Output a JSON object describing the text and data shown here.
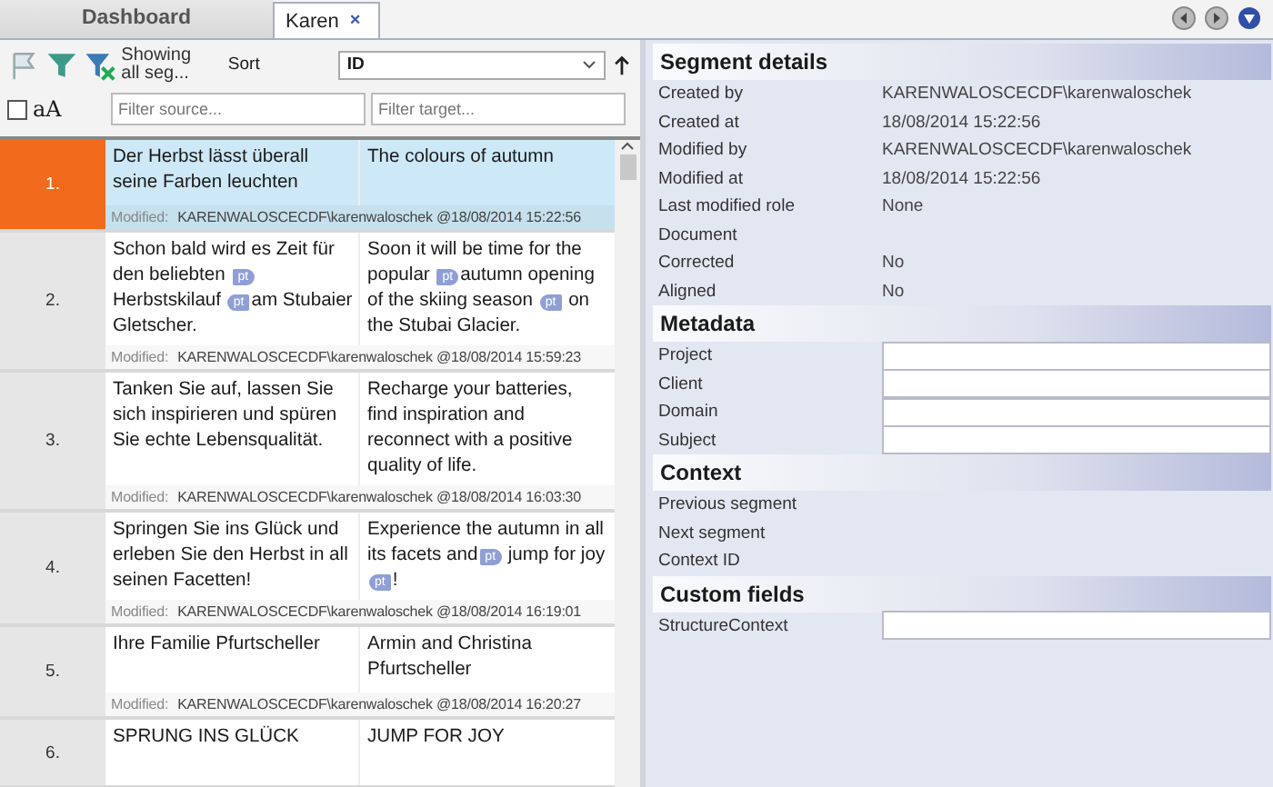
{
  "tabs": [
    {
      "label": "Dashboard",
      "selected": false
    },
    {
      "label": "Karen",
      "selected": true,
      "close": "×"
    }
  ],
  "toolbar": {
    "filter_status": "Showing all seg...",
    "sort_label": "Sort",
    "sort_value": "ID",
    "match_case": {
      "label": "aA",
      "checked": false
    },
    "source_filter": {
      "placeholder": "Filter source..."
    },
    "target_filter": {
      "placeholder": "Filter target..."
    }
  },
  "segments": [
    {
      "number": "1.",
      "selected": true,
      "source": [
        {
          "kind": "text",
          "text": "Der Herbst lässt überall seine Farben leuchten"
        }
      ],
      "target": [
        {
          "kind": "text",
          "text": "The colours of autumn"
        }
      ],
      "modified_label": "Modified:",
      "modified": "KARENWALOSCECDF\\karenwaloschek @18/08/2014 15:22:56"
    },
    {
      "number": "2.",
      "selected": false,
      "source": [
        {
          "kind": "text",
          "text": "Schon bald wird es Zeit für den beliebten "
        },
        {
          "kind": "tag_open",
          "text": "pt"
        },
        {
          "kind": "text",
          "text": "Herbstskilauf "
        },
        {
          "kind": "tag_close",
          "text": "pt"
        },
        {
          "kind": "text",
          "text": "am Stubaier Gletscher."
        }
      ],
      "target": [
        {
          "kind": "text",
          "text": "Soon it will be time for the popular "
        },
        {
          "kind": "tag_open",
          "text": "pt"
        },
        {
          "kind": "text",
          "text": "autumn opening of the skiing season "
        },
        {
          "kind": "tag_close",
          "text": "pt"
        },
        {
          "kind": "text",
          "text": " on the Stubai Glacier."
        }
      ],
      "modified_label": "Modified:",
      "modified": "KARENWALOSCECDF\\karenwaloschek @18/08/2014 15:59:23"
    },
    {
      "number": "3.",
      "selected": false,
      "source": [
        {
          "kind": "text",
          "text": "Tanken Sie auf, lassen Sie sich inspirieren und spüren Sie echte Lebensqualität."
        }
      ],
      "target": [
        {
          "kind": "text",
          "text": "Recharge your batteries, find inspiration and reconnect with a positive quality of life."
        }
      ],
      "modified_label": "Modified:",
      "modified": "KARENWALOSCECDF\\karenwaloschek @18/08/2014 16:03:30"
    },
    {
      "number": "4.",
      "selected": false,
      "source": [
        {
          "kind": "text",
          "text": "Springen Sie ins Glück und erleben Sie den Herbst in all seinen Facetten!"
        }
      ],
      "target": [
        {
          "kind": "text",
          "text": "Experience the autumn in all its facets and"
        },
        {
          "kind": "tag_open",
          "text": "pt"
        },
        {
          "kind": "text",
          "text": " jump for joy "
        },
        {
          "kind": "tag_close",
          "text": "pt"
        },
        {
          "kind": "text",
          "text": "!"
        }
      ],
      "modified_label": "Modified:",
      "modified": "KARENWALOSCECDF\\karenwaloschek @18/08/2014 16:19:01"
    },
    {
      "number": "5.",
      "selected": false,
      "source": [
        {
          "kind": "text",
          "text": "Ihre Familie Pfurtscheller"
        }
      ],
      "target": [
        {
          "kind": "text",
          "text": "Armin and Christina Pfurtscheller"
        }
      ],
      "modified_label": "Modified:",
      "modified": "KARENWALOSCECDF\\karenwaloschek @18/08/2014 16:20:27"
    },
    {
      "number": "6.",
      "selected": false,
      "source": [
        {
          "kind": "text",
          "text": "SPRUNG INS GLÜCK"
        }
      ],
      "target": [
        {
          "kind": "text",
          "text": "JUMP FOR JOY"
        }
      ]
    }
  ],
  "details": [
    {
      "title": "Segment details",
      "rows": [
        {
          "kind": "value",
          "label": "Created by",
          "value": "KARENWALOSCECDF\\karenwaloschek"
        },
        {
          "kind": "value",
          "label": "Created at",
          "value": "18/08/2014 15:22:56"
        },
        {
          "kind": "value",
          "label": "Modified by",
          "value": "KARENWALOSCECDF\\karenwaloschek"
        },
        {
          "kind": "value",
          "label": "Modified at",
          "value": "18/08/2014 15:22:56"
        },
        {
          "kind": "value",
          "label": "Last modified role",
          "value": "None"
        },
        {
          "kind": "value",
          "label": "Document"
        },
        {
          "kind": "value",
          "label": "Corrected",
          "value": "No"
        },
        {
          "kind": "value",
          "label": "Aligned",
          "value": "No"
        }
      ]
    },
    {
      "title": "Metadata",
      "rows": [
        {
          "kind": "field",
          "label": "Project"
        },
        {
          "kind": "field",
          "label": "Client"
        },
        {
          "kind": "field",
          "label": "Domain"
        },
        {
          "kind": "field",
          "label": "Subject"
        }
      ]
    },
    {
      "title": "Context",
      "rows": [
        {
          "kind": "value",
          "label": "Previous segment"
        },
        {
          "kind": "value",
          "label": "Next segment"
        },
        {
          "kind": "value",
          "label": "Context ID"
        }
      ]
    },
    {
      "title": "Custom fields",
      "rows": [
        {
          "kind": "field",
          "label": "StructureContext"
        }
      ]
    }
  ]
}
